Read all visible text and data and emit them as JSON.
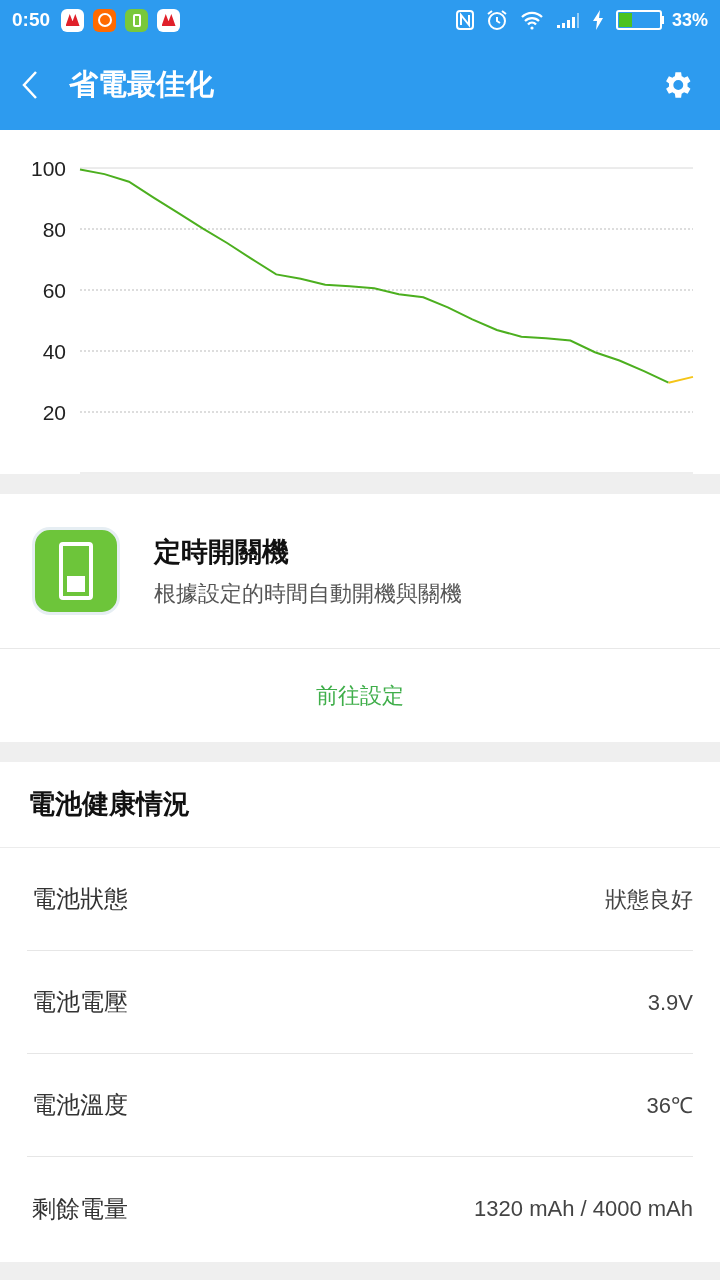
{
  "status_bar": {
    "time": "0:50",
    "battery_percent": "33%"
  },
  "app_bar": {
    "title": "省電最佳化"
  },
  "chart_data": {
    "type": "line",
    "ylim": [
      0,
      100
    ],
    "yticks": [
      20,
      40,
      60,
      80,
      100
    ],
    "categories": [
      null,
      null,
      null,
      null,
      null,
      null,
      null,
      null,
      null,
      null,
      null,
      null,
      null,
      null,
      null,
      null,
      null,
      null,
      null,
      null,
      null,
      null,
      null,
      null,
      null,
      null
    ],
    "grid": true,
    "series": [
      {
        "color": "#4caf1f",
        "values": [
          99.5,
          98,
          95.5,
          90.3,
          85.3,
          80.2,
          75.4,
          70.2,
          65.1,
          63.7,
          61.7,
          61.2,
          60.6,
          58.6,
          57.6,
          54.3,
          50.4,
          46.9,
          44.7,
          44.2,
          43.4,
          39.6,
          36.9,
          33.4,
          29.6,
          null
        ]
      },
      {
        "color": "#f5c518",
        "values": [
          null,
          null,
          null,
          null,
          null,
          null,
          null,
          null,
          null,
          null,
          null,
          null,
          null,
          null,
          null,
          null,
          null,
          null,
          null,
          null,
          null,
          null,
          null,
          null,
          29.6,
          31.5
        ]
      }
    ]
  },
  "scheduled_power": {
    "title": "定時開關機",
    "description": "根據設定的時間自動開機與關機",
    "link": "前往設定"
  },
  "battery_health": {
    "title": "電池健康情況",
    "rows": [
      {
        "label": "電池狀態",
        "value": "狀態良好"
      },
      {
        "label": "電池電壓",
        "value": "3.9V"
      },
      {
        "label": "電池溫度",
        "value": "36℃"
      },
      {
        "label": "剩餘電量",
        "value": "1320 mAh / 4000 mAh"
      }
    ]
  }
}
